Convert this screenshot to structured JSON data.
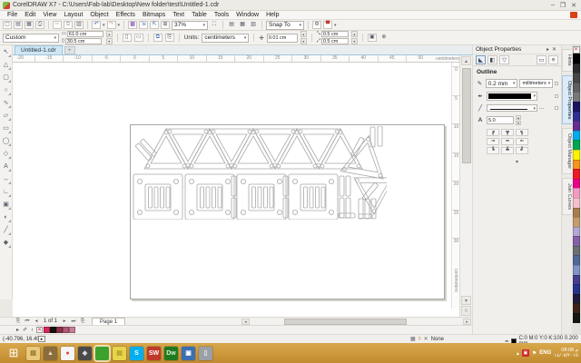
{
  "window": {
    "title": "CorelDRAW X7 - C:\\Users\\Fab-lab\\Desktop\\New folder\\test\\Untitled-1.cdr",
    "minimize": "–",
    "restore": "❐",
    "close": "✕"
  },
  "menu": {
    "items": [
      "File",
      "Edit",
      "View",
      "Layout",
      "Object",
      "Effects",
      "Bitmaps",
      "Text",
      "Table",
      "Tools",
      "Window",
      "Help"
    ]
  },
  "toolbar": {
    "zoom_level": "37%",
    "snap_to_label": "Snap To",
    "snap_arrow": "▾"
  },
  "property_bar": {
    "preset": "Custom",
    "page_width": "61.0 cm",
    "page_height": "30.5 cm",
    "units_label": "Units:",
    "units_value": "centimeters",
    "nudge_value": "0.01 cm",
    "duplicate_x": "0.5 cm",
    "duplicate_y": "0.5 cm"
  },
  "document": {
    "tab_label": "Untitled-1.cdr",
    "new_tab": "+",
    "page_count": "1 of 1",
    "page_tab": "Page 1"
  },
  "rulers": {
    "h_ticks": [
      "-20",
      "-15",
      "-10",
      "-5",
      "0",
      "5",
      "10",
      "15",
      "20",
      "25",
      "30",
      "35",
      "40",
      "45",
      "50"
    ],
    "v_ticks": [
      "0",
      "5",
      "10",
      "15",
      "20",
      "25",
      "30"
    ],
    "unit_label": "centimeters"
  },
  "toolbox": {
    "tools": [
      {
        "name": "pick",
        "glyph": "↖"
      },
      {
        "name": "shape",
        "glyph": "△"
      },
      {
        "name": "crop",
        "glyph": "▢"
      },
      {
        "name": "zoom",
        "glyph": "○"
      },
      {
        "name": "freehand",
        "glyph": "∿"
      },
      {
        "name": "artistic-media",
        "glyph": "▱"
      },
      {
        "name": "rectangle",
        "glyph": "▭"
      },
      {
        "name": "ellipse",
        "glyph": "◯"
      },
      {
        "name": "polygon",
        "glyph": "◇"
      },
      {
        "name": "text",
        "glyph": "A"
      },
      {
        "name": "parallel-dimension",
        "glyph": "↔"
      },
      {
        "name": "connector",
        "glyph": "∟"
      },
      {
        "name": "drop-shadow",
        "glyph": "▣"
      },
      {
        "name": "transparency",
        "glyph": "◐"
      },
      {
        "name": "color-eyedropper",
        "glyph": "╱"
      },
      {
        "name": "interactive-fill",
        "glyph": "◆"
      }
    ]
  },
  "docker": {
    "title": "Object Properties",
    "section": "Outline",
    "width_value": "0.2 mm",
    "width_units": "millimeters",
    "style_more": "...",
    "miter_icon": "A",
    "miter_value": "5.0",
    "corner_buttons": [
      "┏",
      "┳",
      "┓",
      "╼",
      "━",
      "╾",
      "┗",
      "┻",
      "┛"
    ],
    "expand_arrow": "▾",
    "tabs": [
      "Hints",
      "Object Properties",
      "Object Manager",
      "Join Curves"
    ],
    "selected_tab": "Object Properties"
  },
  "palette": {
    "colors": [
      "#000000",
      "#2b2b2b",
      "#454545",
      "#5e5e5e",
      "#787878",
      "#1b1464",
      "#2e3192",
      "#662d91",
      "#00aeef",
      "#00a651",
      "#fff200",
      "#f7941d",
      "#ed1c24",
      "#ec008c",
      "#f49ac1",
      "#f6c0cb",
      "#a97c50",
      "#c69c6d",
      "#b5a6d4",
      "#8560a8",
      "#6d6e71",
      "#4f6898",
      "#8393ca",
      "#443f8f",
      "#27348b",
      "#1c1c3a",
      "#3b2314",
      "#151515"
    ]
  },
  "doc_palette": {
    "colors": [
      "#d6275c",
      "#111111",
      "#8c3049",
      "#b05878",
      "#c77d96"
    ]
  },
  "status": {
    "coords": "(-40.796, 16.401)",
    "fill_none_label": "None",
    "outline_info": "C:0 M:0 Y:0 K:100  0.200 mm"
  },
  "taskbar": {
    "start_glyph": "⊞",
    "apps": [
      {
        "name": "file-explorer",
        "color": "#e8c87a",
        "glyph": "▤",
        "glyph_color": "#8a6d1f"
      },
      {
        "name": "modeling-app",
        "color": "#8a6d3b",
        "glyph": "▲",
        "glyph_color": "#e8dcc0"
      },
      {
        "name": "chrome",
        "color": "#f5f5f5",
        "glyph": "●",
        "glyph_color": "#db4437"
      },
      {
        "name": "inkscape",
        "color": "#4a4a4a",
        "glyph": "◆",
        "glyph_color": "#dddddd"
      },
      {
        "name": "coreldraw",
        "color": "#3da12e",
        "glyph": "",
        "glyph_color": "#ffffff",
        "active": true
      },
      {
        "name": "sticky-notes",
        "color": "#e6d44a",
        "glyph": "▤",
        "glyph_color": "#a99a1f"
      },
      {
        "name": "skype",
        "color": "#00aff0",
        "glyph": "S",
        "glyph_color": "#ffffff"
      },
      {
        "name": "solidworks",
        "color": "#c0392b",
        "glyph": "SW",
        "glyph_color": "#ffffff"
      },
      {
        "name": "dreamweaver",
        "color": "#1f7a1f",
        "glyph": "Dw",
        "glyph_color": "#d8f0d0"
      },
      {
        "name": "remote-desktop",
        "color": "#3b6fb3",
        "glyph": "▣",
        "glyph_color": "#ffffff"
      },
      {
        "name": "hardware",
        "color": "#9aa0a6",
        "glyph": "▯",
        "glyph_color": "#eeeeee"
      }
    ],
    "tray": {
      "hidden_icons": "▴",
      "flag": "⚑",
      "language": "ENG",
      "time": "08:08 م",
      "date": "١٤/٠٥/٢٠١٥"
    }
  }
}
